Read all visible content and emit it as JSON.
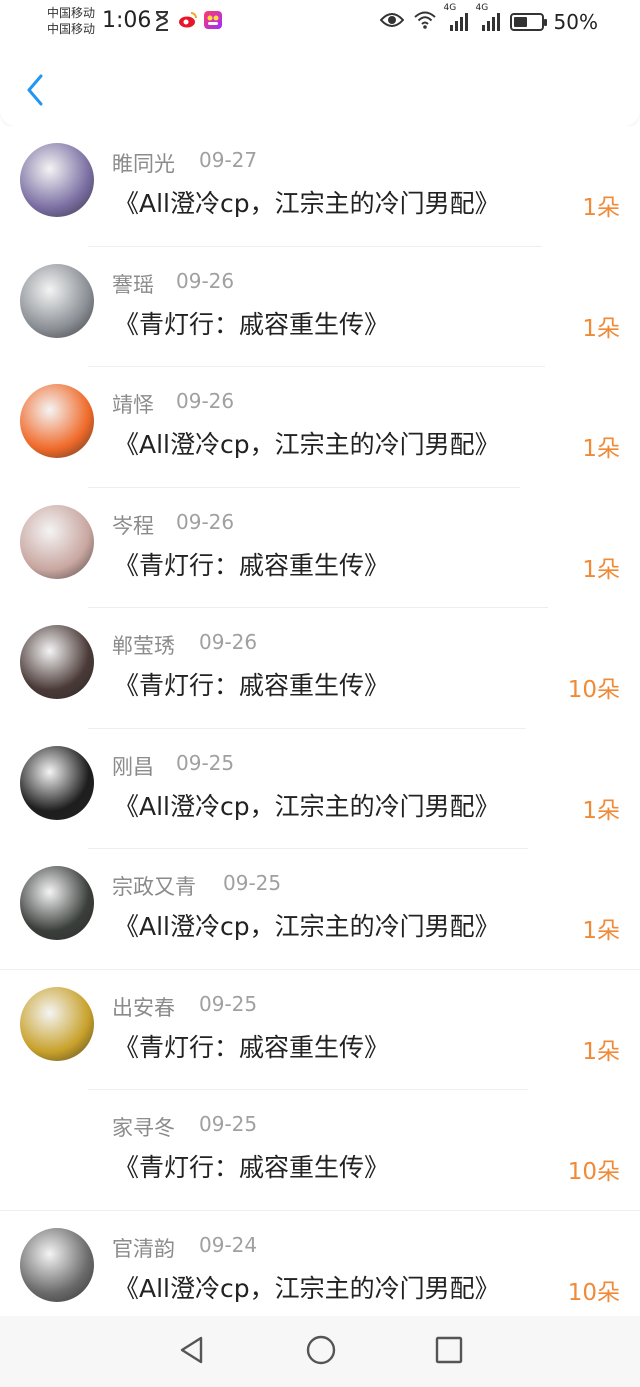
{
  "status_bar": {
    "carrier_line1": "中国移动",
    "carrier_line2": "中国移动",
    "time": "1:06",
    "network_1": "4G",
    "network_2": "4G",
    "battery_level": 0.5,
    "battery_text": "50%"
  },
  "header": {
    "back_icon": "chevron-left-icon"
  },
  "rows": [
    {
      "name": "睢同光",
      "date": "09-27",
      "title": "《All澄冷cp，江宗主的冷门男配》",
      "count": "1朵",
      "avatar_color": "#7b6fa3",
      "has_avatar": true
    },
    {
      "name": "謇瑶",
      "date": "09-26",
      "title": "《青灯行：戚容重生传》",
      "count": "1朵",
      "avatar_color": "#8a8f95",
      "has_avatar": true
    },
    {
      "name": "靖怿",
      "date": "09-26",
      "title": "《All澄冷cp，江宗主的冷门男配》",
      "count": "1朵",
      "avatar_color": "#f06a2a",
      "has_avatar": true
    },
    {
      "name": "岑程",
      "date": "09-26",
      "title": "《青灯行：戚容重生传》",
      "count": "1朵",
      "avatar_color": "#c9a6a0",
      "has_avatar": true
    },
    {
      "name": "郸莹琇",
      "date": "09-26",
      "title": "《青灯行：戚容重生传》",
      "count": "10朵",
      "avatar_color": "#4a3a37",
      "has_avatar": true
    },
    {
      "name": "刚昌",
      "date": "09-25",
      "title": "《All澄冷cp，江宗主的冷门男配》",
      "count": "1朵",
      "avatar_color": "#1e1e1e",
      "has_avatar": true
    },
    {
      "name": "宗政又青",
      "date": "09-25",
      "title": "《All澄冷cp，江宗主的冷门男配》",
      "count": "1朵",
      "avatar_color": "#3b3f3c",
      "has_avatar": true
    },
    {
      "name": "出安春",
      "date": "09-25",
      "title": "《青灯行：戚容重生传》",
      "count": "1朵",
      "avatar_color": "#c8a12a",
      "has_avatar": true
    },
    {
      "name": "家寻冬",
      "date": "09-25",
      "title": "《青灯行：戚容重生传》",
      "count": "10朵",
      "avatar_color": "#ffffff",
      "has_avatar": false
    },
    {
      "name": "官清韵",
      "date": "09-24",
      "title": "《All澄冷cp，江宗主的冷门男配》",
      "count": "10朵",
      "avatar_color": "#6a6a6a",
      "has_avatar": true
    }
  ],
  "nav": {
    "back_icon": "triangle-back-icon",
    "home_icon": "circle-home-icon",
    "recent_icon": "square-recent-icon"
  },
  "colors": {
    "accent": "#2196f3",
    "count": "#f08a37",
    "name": "#8b8b8b"
  }
}
